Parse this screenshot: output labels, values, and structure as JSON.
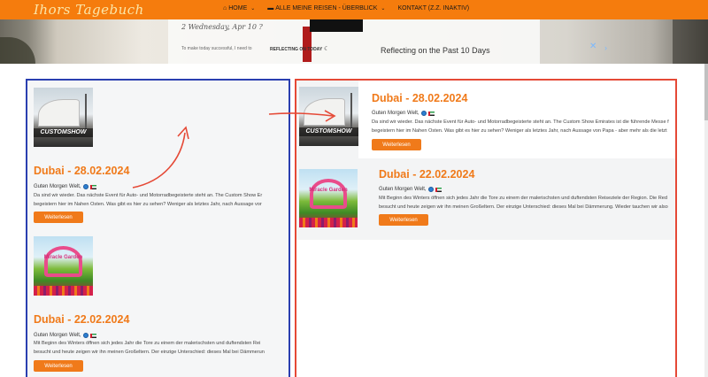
{
  "header": {
    "logo": "Ihors Tagebuch",
    "nav": [
      {
        "icon": "home-icon",
        "glyph": "⌂",
        "label": "HOME",
        "has_dropdown": true
      },
      {
        "icon": "suitcase-icon",
        "glyph": "▬",
        "label": "ALLE MEINE REISEN - ÜBERBLICK",
        "has_dropdown": true
      },
      {
        "icon": "",
        "glyph": "",
        "label": "KONTAKT (Z.Z. INAKTIV)",
        "has_dropdown": false
      }
    ]
  },
  "hero": {
    "date_text": "2 Wednesday, Apr 10 ?",
    "small_note": "To make today successful, I need to",
    "reflect_small": "REFLECTING ON TODAY",
    "reflect_big": "Reflecting on the Past 10 Days"
  },
  "posts_left": [
    {
      "title": "Dubai - 28.02.2024",
      "greeting": "Guten Morgen Welt,",
      "line1": "Da sind wir wieder. Das nächste Event für Auto- und Motorradbegeisterte steht an. The Custom Show Er",
      "line2": "begeistern hier im Nahen Osten. Was gibt es hier zu sehen? Weniger als letztes Jahr, nach Aussage vor",
      "button": "Weiterlesen",
      "thumb_caption": "CUSTOMSHOW"
    },
    {
      "title": "Dubai - 22.02.2024",
      "greeting": "Guten Morgen Welt,",
      "line1": "Mit Beginn des Winters öffnen sich jedes Jahr die Tore zu einem der malerischsten und duftendsten Rei",
      "line2": "besucht und heute zeigen wir ihn meinen Großeltern. Der einzige Unterschied: dieses Mal bei Dämmerun",
      "button": "Weiterlesen",
      "thumb_caption": "Miracle Garden"
    }
  ],
  "posts_right": [
    {
      "title": "Dubai - 28.02.2024",
      "greeting": "Guten Morgen Welt,",
      "line1": "Da sind wir wieder. Das nächste Event für Auto- und Motorradbegeisterte steht an. The Custom Show Emirates ist die führende Messe f",
      "line2": "begeistern hier im Nahen Osten. Was gibt es hier zu sehen? Weniger als letztes Jahr, nach Aussage von Papa - aber mehr als die letzt",
      "button": "Weiterlesen",
      "thumb_caption": "CUSTOMSHOW"
    },
    {
      "title": "Dubai - 22.02.2024",
      "greeting": "Guten Morgen Welt,",
      "line1": "Mit Beginn des Winters öffnen sich jedes Jahr die Tore zu einem der malerischsten und duftendsten Reiseziele der Region. Die Red",
      "line2": "besucht und heute zeigen wir ihn meinen Großeltern. Der einzige Unterschied: dieses Mal bei Dämmerung. Wieder tauchen wir also",
      "button": "Weiterlesen",
      "thumb_caption": "Miracle Garden"
    }
  ],
  "colors": {
    "accent": "#f07a1a",
    "topbar": "#f57c0d",
    "frame_left": "#2a3fb0",
    "frame_right": "#e54936",
    "arrow": "#e54936"
  }
}
